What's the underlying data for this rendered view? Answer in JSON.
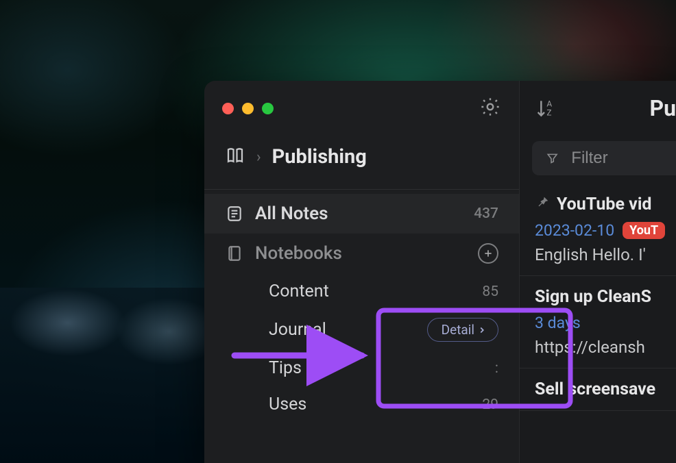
{
  "sidebar": {
    "breadcrumb_title": "Publishing",
    "all_notes": {
      "label": "All Notes",
      "count": "437"
    },
    "notebooks_label": "Notebooks",
    "notebooks": [
      {
        "label": "Content",
        "count": "85"
      },
      {
        "label": "Journal",
        "detail_label": "Detail"
      },
      {
        "label": "Tips",
        "count": ":"
      },
      {
        "label": "Uses",
        "count": "29"
      }
    ]
  },
  "content": {
    "title_partial": "Pu",
    "filter_placeholder": "Filter"
  },
  "notes": [
    {
      "pinned": true,
      "title_partial": "YouTube vid",
      "date": "2023-02-10",
      "tag_partial": "YouT",
      "preview_partial": "English Hello. I'"
    },
    {
      "title_partial": "Sign up CleanS",
      "date": "3 days",
      "preview_partial": "https://cleansh"
    },
    {
      "title_partial": "Sell screensave"
    }
  ],
  "annotation": {
    "color": "#9d4df5"
  }
}
